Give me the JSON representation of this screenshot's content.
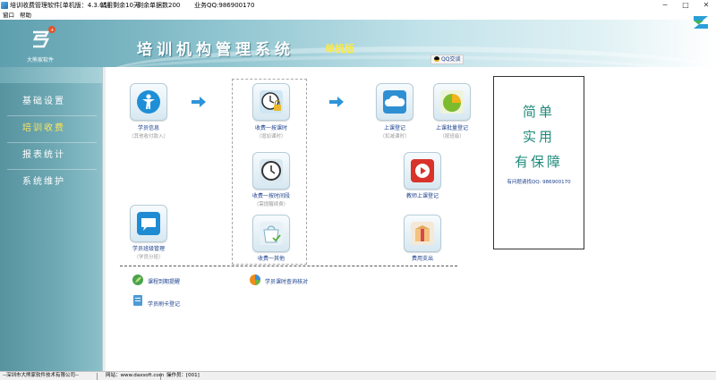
{
  "window": {
    "title": "培训收费管理软件[单机版：4.3.05]",
    "trial": "试用剩余10天",
    "remaining": "剩余单据数200",
    "qq_business": "业务QQ:986900170",
    "minimize": "─",
    "maximize": "□",
    "close": "✕"
  },
  "menu": {
    "items": [
      "窗口",
      "帮助"
    ]
  },
  "banner": {
    "logo_text": "大熊家软件",
    "title": "培训机构管理系统",
    "edition": "单机版",
    "qq_button": "QQ交谈"
  },
  "sidebar": {
    "items": [
      "基础设置",
      "培训收费",
      "报表统计",
      "系统维护"
    ],
    "active_index": 1
  },
  "modules": {
    "student_info": {
      "label": "学员信息",
      "sub": "（其他收付款入）"
    },
    "charge_buy": {
      "label": "收费一按课时",
      "sub": "（增加课时）"
    },
    "class_register": {
      "label": "上课登记",
      "sub": "（扣减课时）"
    },
    "batch_register": {
      "label": "上课批量登记",
      "sub": "（按班级）"
    },
    "charge_period": {
      "label": "收费一按时间段",
      "sub": "（需提醒续费）"
    },
    "teacher_register": {
      "label": "教师上课登记"
    },
    "student_class": {
      "label": "学员班级管理",
      "sub": "（学员分班）"
    },
    "charge_other": {
      "label": "收费一其他"
    },
    "expense": {
      "label": "费用支出"
    },
    "course_expiry": {
      "label": "课程到期提醒"
    },
    "hours_check": {
      "label": "学员课时查询核对"
    },
    "card_register": {
      "label": "学员刷卡登记"
    }
  },
  "notice": {
    "lines": [
      "简单",
      "实用",
      "有保障"
    ],
    "contact": "有问题请找QQ: 986900170"
  },
  "status": {
    "company": "--深圳市大熊家软件技术有限公司--",
    "website": "网站：www.daxsoft.com",
    "operator": "操作员：[001]"
  },
  "colors": {
    "banner_teal": "#5e9fae",
    "sidebar_teal": "#6ea9b4",
    "active_yellow": "#ffe65a",
    "label_blue": "#1a3f8c",
    "notice_green": "#1f8a7a"
  }
}
